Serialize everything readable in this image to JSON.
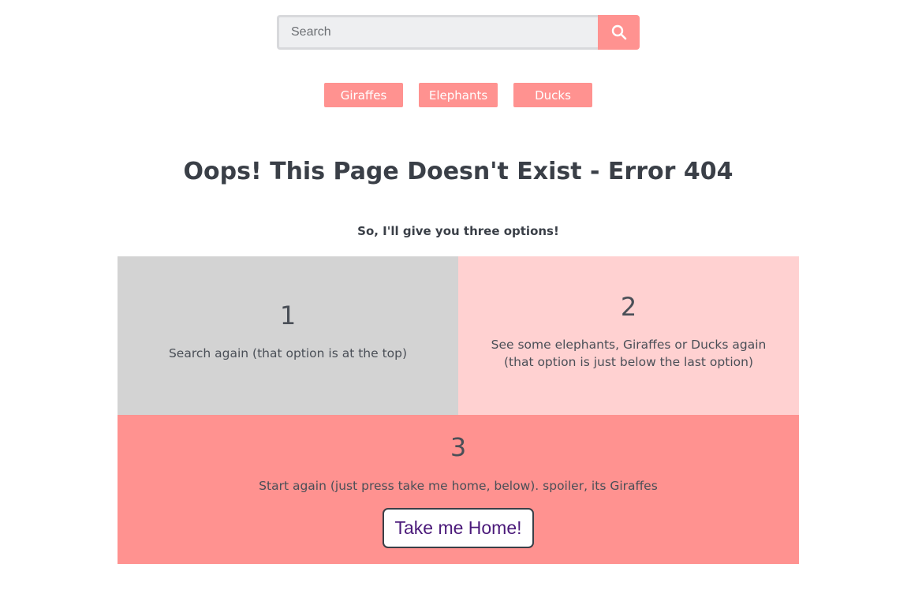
{
  "search": {
    "placeholder": "Search",
    "value": "",
    "button_icon": "search-icon"
  },
  "categories": [
    {
      "label": "Giraffes"
    },
    {
      "label": "Elephants"
    },
    {
      "label": "Ducks"
    }
  ],
  "main": {
    "title": "Oops! This Page Doesn't Exist - Error 404",
    "subtitle": "So, I'll give you three options!"
  },
  "options": [
    {
      "number": "1",
      "text": "Search again (that option is at the top)"
    },
    {
      "number": "2",
      "text": "See some elephants, Giraffes or Ducks again (that option is just below the last option)"
    },
    {
      "number": "3",
      "text": "Start again (just press take me home, below). spoiler, its Giraffes"
    }
  ],
  "home_button": {
    "label": "Take me Home!"
  },
  "colors": {
    "accent": "#ff9290",
    "option1_bg": "#d3d3d3",
    "option2_bg": "#ffd1d1",
    "option3_bg": "#ff9290",
    "text": "#3a3f47"
  }
}
